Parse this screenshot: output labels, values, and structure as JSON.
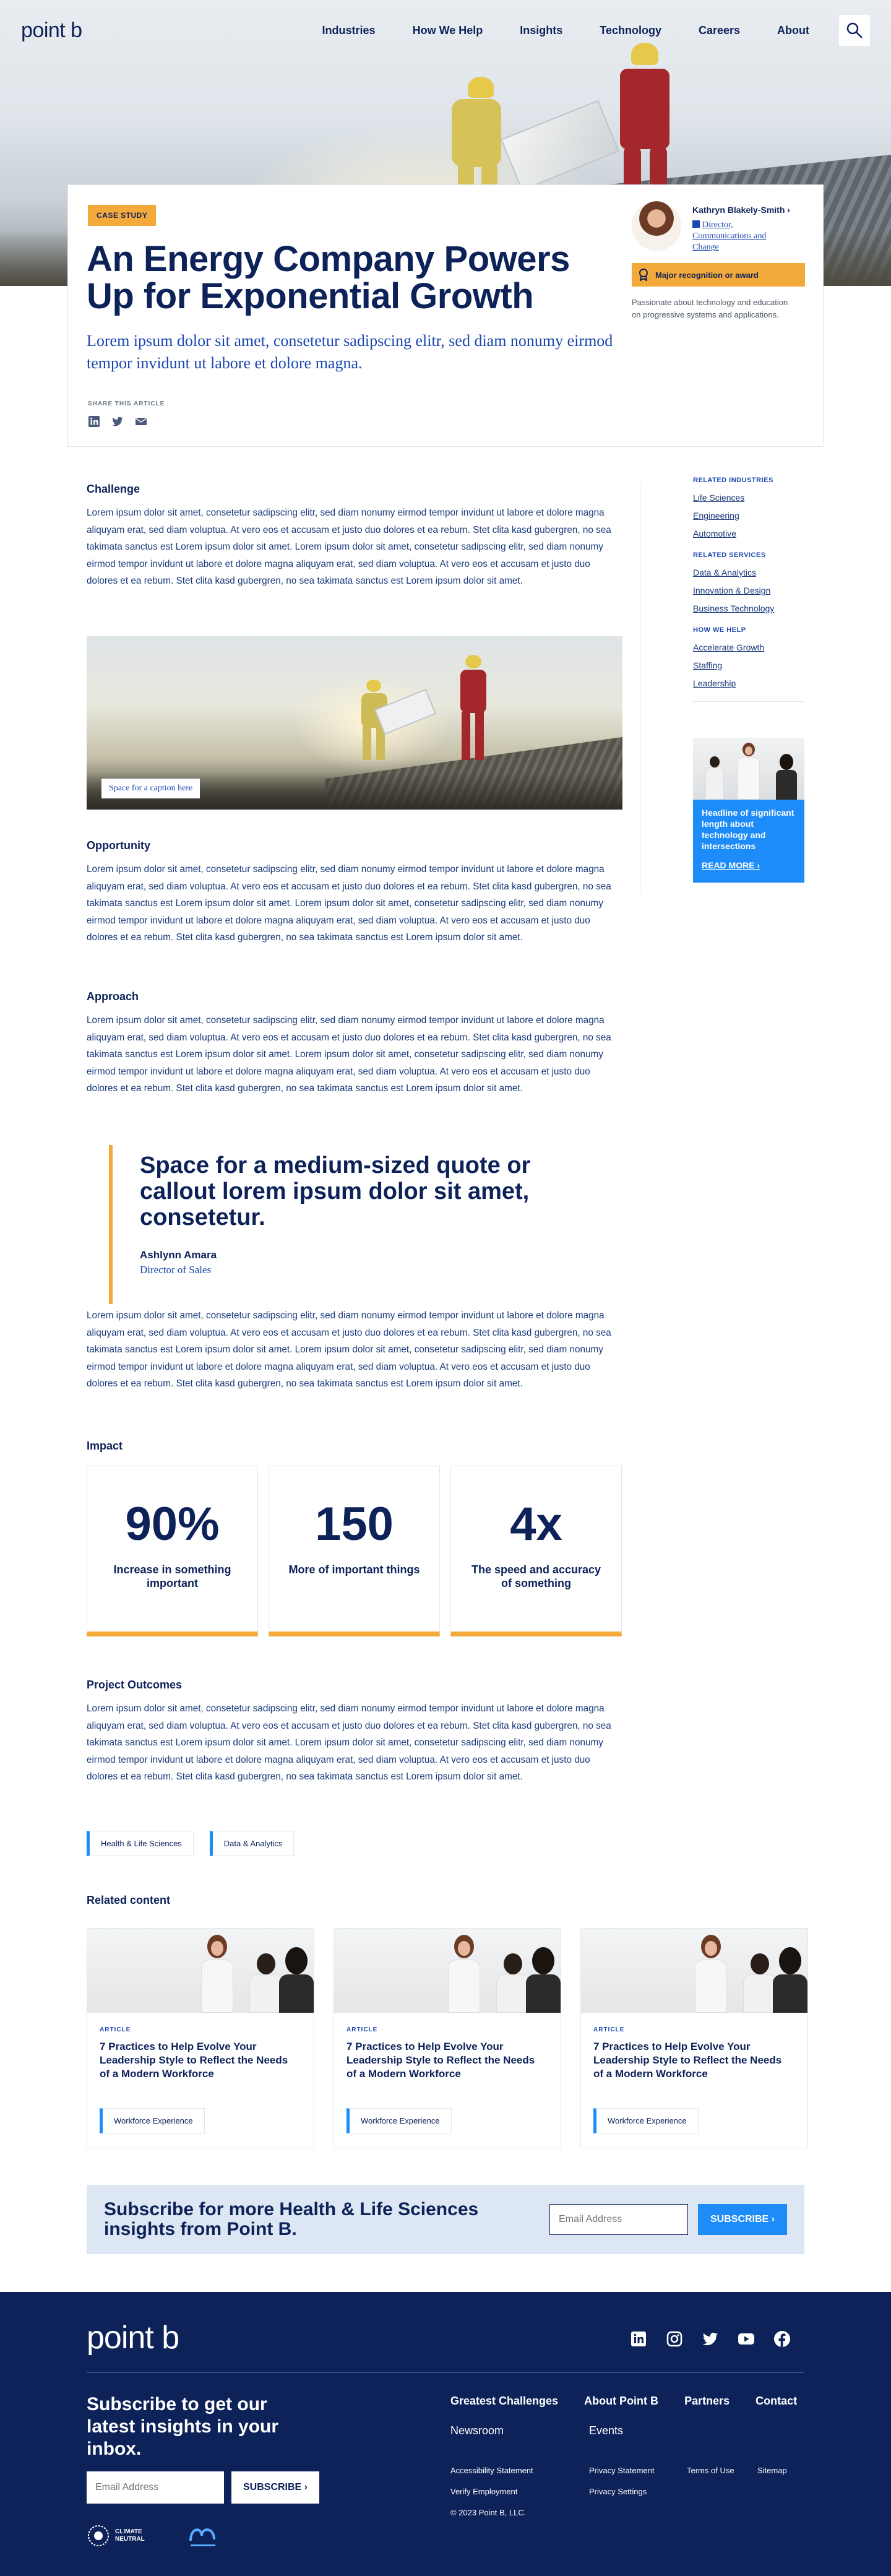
{
  "nav": {
    "logo": "point b",
    "links": [
      "Industries",
      "How We Help",
      "Insights",
      "Technology",
      "Careers",
      "About"
    ]
  },
  "case": {
    "tag": "CASE STUDY",
    "title": "An Energy Company Powers Up for Exponential Growth",
    "subtitle": "Lorem ipsum dolor sit amet, consetetur sadipscing elitr, sed diam nonumy eirmod tempor invidunt ut labore et dolore magna.",
    "share_label": "SHARE THIS ARTICLE",
    "author": {
      "name": "Kathryn Blakely-Smith",
      "role": "Director, Communications and Change",
      "award": "Major recognition or award",
      "bio": "Passionate about technology and education on progressive systems and applications."
    }
  },
  "article": {
    "challenge_heading": "Challenge",
    "challenge_text": "Lorem ipsum dolor sit amet, consetetur sadipscing elitr, sed diam nonumy eirmod tempor invidunt ut labore et dolore magna aliquyam erat, sed diam voluptua. At vero eos et accusam et justo duo dolores et ea rebum. Stet clita kasd gubergren, no sea takimata sanctus est Lorem ipsum dolor sit amet. Lorem ipsum dolor sit amet, consetetur sadipscing elitr, sed diam nonumy eirmod tempor invidunt ut labore et dolore magna aliquyam erat, sed diam voluptua. At vero eos et accusam et justo duo dolores et ea rebum. Stet clita kasd gubergren, no sea takimata sanctus est Lorem ipsum dolor sit amet.",
    "image_caption": "Space for a caption here",
    "opportunity_heading": "Opportunity",
    "opportunity_text": "Lorem ipsum dolor sit amet, consetetur sadipscing elitr, sed diam nonumy eirmod tempor invidunt ut labore et dolore magna aliquyam erat, sed diam voluptua. At vero eos et accusam et justo duo dolores et ea rebum. Stet clita kasd gubergren, no sea takimata sanctus est Lorem ipsum dolor sit amet. Lorem ipsum dolor sit amet, consetetur sadipscing elitr, sed diam nonumy eirmod tempor invidunt ut labore et dolore magna aliquyam erat, sed diam voluptua. At vero eos et accusam et justo duo dolores et ea rebum. Stet clita kasd gubergren, no sea takimata sanctus est Lorem ipsum dolor sit amet.",
    "approach_heading": "Approach",
    "approach_text": "Lorem ipsum dolor sit amet, consetetur sadipscing elitr, sed diam nonumy eirmod tempor invidunt ut labore et dolore magna aliquyam erat, sed diam voluptua. At vero eos et accusam et justo duo dolores et ea rebum. Stet clita kasd gubergren, no sea takimata sanctus est Lorem ipsum dolor sit amet. Lorem ipsum dolor sit amet, consetetur sadipscing elitr, sed diam nonumy eirmod tempor invidunt ut labore et dolore magna aliquyam erat, sed diam voluptua. At vero eos et accusam et justo duo dolores et ea rebum. Stet clita kasd gubergren, no sea takimata sanctus est Lorem ipsum dolor sit amet.",
    "quote": {
      "text": "Space for a medium-sized quote or callout  lorem ipsum dolor sit amet, consetetur.",
      "name": "Ashlynn Amara",
      "title": "Director of Sales"
    },
    "after_quote_text": "Lorem ipsum dolor sit amet, consetetur sadipscing elitr, sed diam nonumy eirmod tempor invidunt ut labore et dolore magna aliquyam erat, sed diam voluptua. At vero eos et accusam et justo duo dolores et ea rebum. Stet clita kasd gubergren, no sea takimata sanctus est Lorem ipsum dolor sit amet. Lorem ipsum dolor sit amet, consetetur sadipscing elitr, sed diam nonumy eirmod tempor invidunt ut labore et dolore magna aliquyam erat, sed diam voluptua. At vero eos et accusam et justo duo dolores et ea rebum. Stet clita kasd gubergren, no sea takimata sanctus est Lorem ipsum dolor sit amet.",
    "impact_heading": "Impact",
    "stats": [
      {
        "value": "90%",
        "label": "Increase in something important"
      },
      {
        "value": "150",
        "label": "More of important things"
      },
      {
        "value": "4x",
        "label": "The speed and accuracy of something"
      }
    ],
    "outcomes_heading": "Project Outcomes",
    "outcomes_text": "Lorem ipsum dolor sit amet, consetetur sadipscing elitr, sed diam nonumy eirmod tempor invidunt ut labore et dolore magna aliquyam erat, sed diam voluptua. At vero eos et accusam et justo duo dolores et ea rebum. Stet clita kasd gubergren, no sea takimata sanctus est Lorem ipsum dolor sit amet. Lorem ipsum dolor sit amet, consetetur sadipscing elitr, sed diam nonumy eirmod tempor invidunt ut labore et dolore magna aliquyam erat, sed diam voluptua. At vero eos et accusam et justo duo dolores et ea rebum. Stet clita kasd gubergren, no sea takimata sanctus est Lorem ipsum dolor sit amet.",
    "tags": [
      "Health & Life Sciences",
      "Data & Analytics"
    ]
  },
  "related": {
    "heading": "Related content",
    "cards": [
      {
        "kind": "ARTICLE",
        "title": "7 Practices to Help Evolve Your Leadership Style to Reflect the Needs of a Modern Workforce",
        "tag": "Workforce Experience"
      },
      {
        "kind": "ARTICLE",
        "title": "7 Practices to Help Evolve Your Leadership Style to Reflect the Needs of a Modern Workforce",
        "tag": "Workforce Experience"
      },
      {
        "kind": "ARTICLE",
        "title": "7 Practices to Help Evolve Your Leadership Style to Reflect the Needs of a Modern Workforce",
        "tag": "Workforce Experience"
      }
    ]
  },
  "sidebar": {
    "industries_head": "RELATED INDUSTRIES",
    "industries": [
      "Life Sciences",
      "Engineering",
      "Automotive"
    ],
    "services_head": "RELATED SERVICES",
    "services": [
      "Data & Analytics",
      "Innovation & Design",
      "Business Technology"
    ],
    "help_head": "HOW WE HELP",
    "help": [
      "Accelerate Growth",
      "Staffing",
      "Leadership"
    ],
    "promo_text": "Headline of significant length about technology and intersections",
    "promo_cta": "READ MORE"
  },
  "subscribe": {
    "text": "Subscribe for more Health & Life Sciences insights from Point B.",
    "placeholder": "Email Address",
    "button": "SUBSCRIBE"
  },
  "footer": {
    "logo": "point b",
    "title": "Subscribe to get our latest insights in your inbox.",
    "placeholder": "Email Address",
    "button": "SUBSCRIBE",
    "badge1": "CLIMATE NEUTRAL",
    "nav": [
      "Greatest Challenges",
      "About Point B",
      "Partners",
      "Contact"
    ],
    "sub": [
      "Newsroom",
      "Events"
    ],
    "legal": {
      "accessibility": "Accessibility Statement",
      "verify": "Verify Employment",
      "copyright": "© 2023 Point B, LLC.",
      "privacy": "Privacy Statement",
      "privacy_settings": "Privacy Settings",
      "terms": "Terms of Use",
      "sitemap": "Sitemap"
    }
  },
  "colors": {
    "navy": "#0d2259",
    "orange": "#f4a93b",
    "blue": "#1d8cf8",
    "link": "#1a47b0"
  }
}
